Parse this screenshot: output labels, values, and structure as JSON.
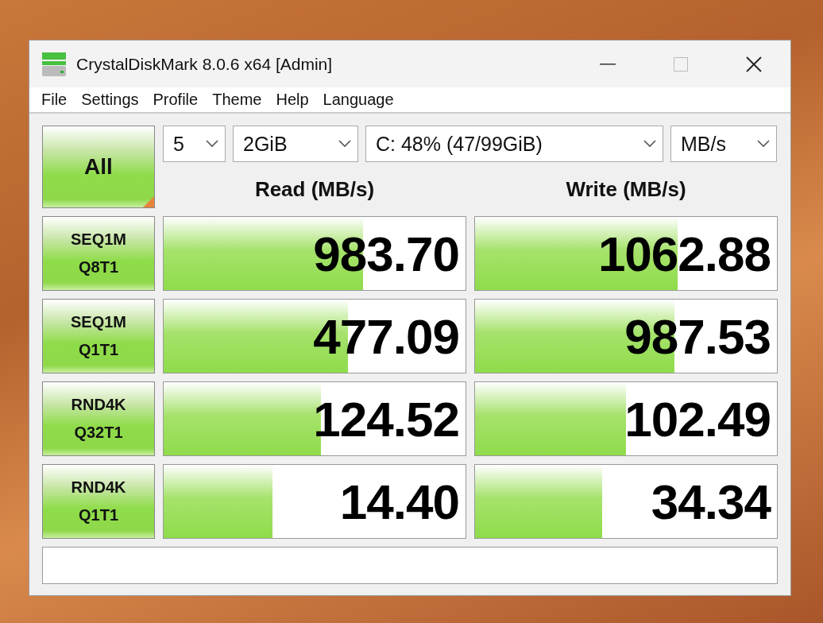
{
  "window": {
    "title": "CrystalDiskMark 8.0.6 x64 [Admin]"
  },
  "menu": [
    "File",
    "Settings",
    "Profile",
    "Theme",
    "Help",
    "Language"
  ],
  "all_button": {
    "label": "All"
  },
  "selects": [
    {
      "value": "5"
    },
    {
      "value": "2GiB"
    },
    {
      "value": "C: 48% (47/99GiB)"
    },
    {
      "value": "MB/s"
    }
  ],
  "columns": [
    "Read (MB/s)",
    "Write (MB/s)"
  ],
  "rows": [
    {
      "test": [
        "SEQ1M",
        "Q8T1"
      ],
      "read": {
        "value": "983.70",
        "level": 0.66
      },
      "write": {
        "value": "1062.88",
        "level": 0.67
      }
    },
    {
      "test": [
        "SEQ1M",
        "Q1T1"
      ],
      "read": {
        "value": "477.09",
        "level": 0.61
      },
      "write": {
        "value": "987.53",
        "level": 0.66
      }
    },
    {
      "test": [
        "RND4K",
        "Q32T1"
      ],
      "read": {
        "value": "124.52",
        "level": 0.52
      },
      "write": {
        "value": "102.49",
        "level": 0.5
      }
    },
    {
      "test": [
        "RND4K",
        "Q1T1"
      ],
      "read": {
        "value": "14.40",
        "level": 0.36
      },
      "write": {
        "value": "34.34",
        "level": 0.42
      }
    }
  ]
}
